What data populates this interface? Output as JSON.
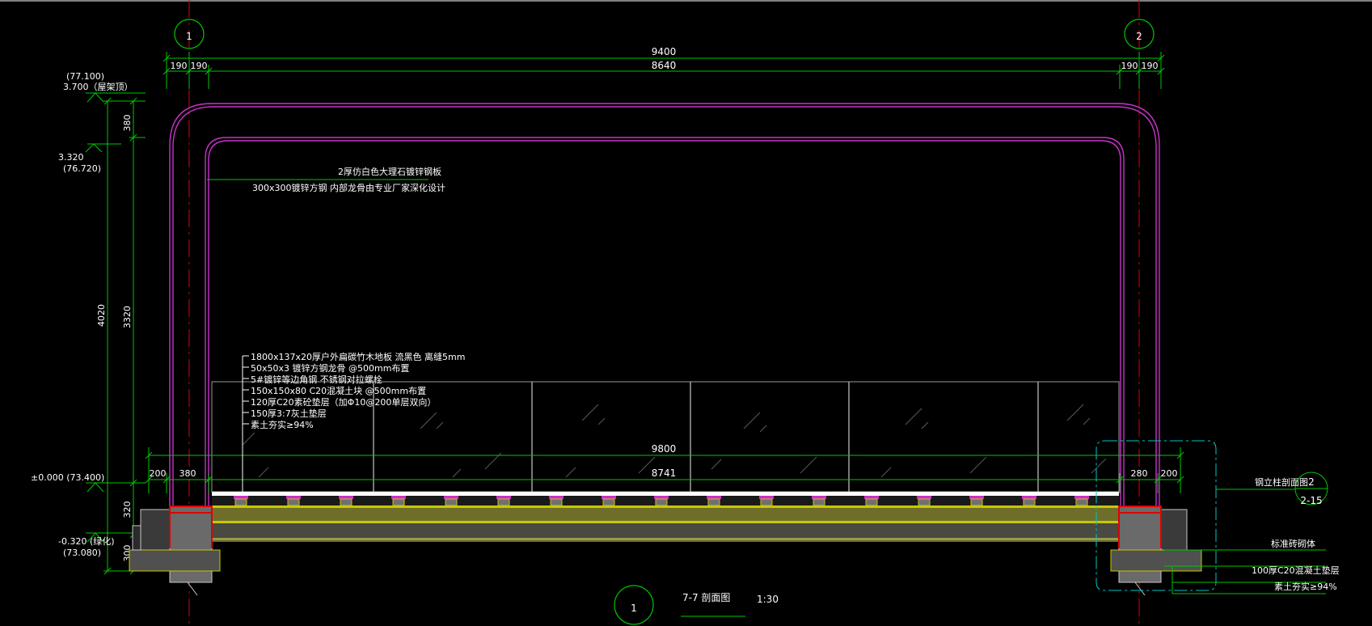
{
  "grid_bubbles": {
    "left": "1",
    "right": "2"
  },
  "dimensions_top": {
    "overall": "9400",
    "inner": "8640",
    "left_a": "190",
    "left_b": "190",
    "right_a": "190",
    "right_b": "190"
  },
  "dimensions_bottom": {
    "overall": "9800",
    "inner": "8741",
    "left_a": "200",
    "left_b": "380",
    "right_a": "280",
    "right_b": "200"
  },
  "dimensions_vertical": {
    "total": "4020",
    "top": "380",
    "middle": "3320",
    "bottom": "320",
    "base": "300"
  },
  "elevations": {
    "top_paren": "(77.100)",
    "top": "3.700（屋架顶）",
    "mid": "3.320",
    "mid_paren": "(76.720)",
    "zero": "±0.000 (73.400)",
    "low": "-0.320 (绿化)",
    "low_paren": "(73.080)"
  },
  "annotations_frame": [
    "2厚仿白色大理石镀锌钢板",
    "300x300镀锌方钢 内部龙骨由专业厂家深化设计"
  ],
  "annotations_floor": [
    "1800x137x20厚户外扁碳竹木地板 流黑色 离缝5mm",
    "50x50x3 镀锌方钢龙骨 @500mm布置",
    "5#镀锌等边角钢 不锈钢对拉螺栓",
    "150x150x80 C20混凝土块 @500mm布置",
    "120厚C20素砼垫层（加Φ10@200单层双向）",
    "150厚3:7灰土垫层",
    "素土夯实≥94%"
  ],
  "annotations_right": {
    "detail_label": "钢立柱剖面图",
    "detail_num": "2",
    "detail_sheet": "2-15",
    "wall": "标准砖砌体",
    "concrete": "100厚C20混凝土垫层",
    "soil": "素土夯实≥94%"
  },
  "title": {
    "number": "1",
    "name": "7-7 剖面图",
    "scale": "1:30"
  },
  "colors": {
    "background": "#000000",
    "frame": "#c832c8",
    "dimension": "#00c800",
    "axis": "#e00000",
    "callout": "#ffffff",
    "glass": "#c8c8c8",
    "cyan": "#00c8c8",
    "pedestal": "#c8c800"
  }
}
